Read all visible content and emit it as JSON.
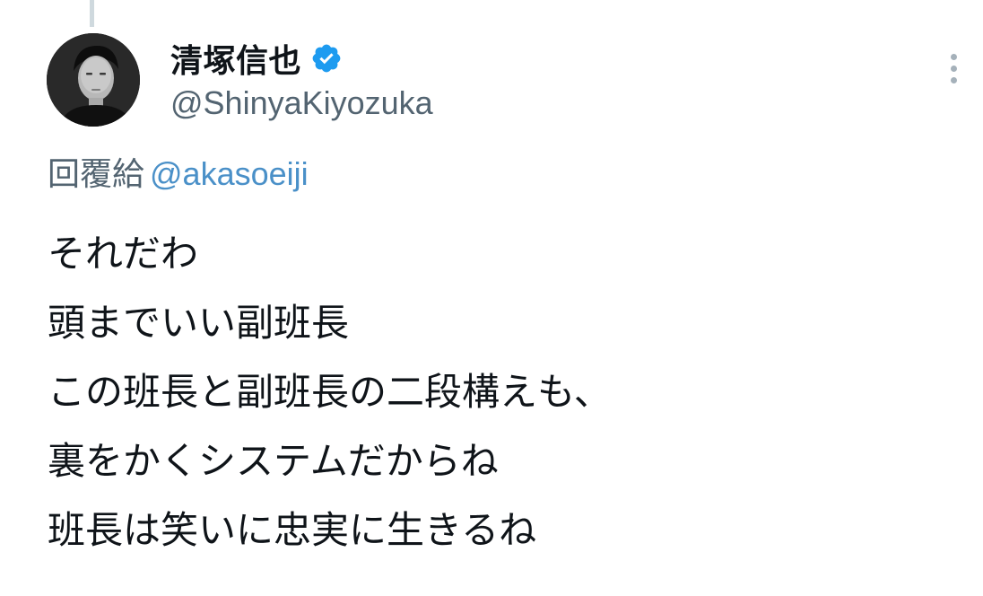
{
  "author": {
    "display_name": "清塚信也",
    "handle": "@ShinyaKiyozuka",
    "verified": true,
    "avatar_icon": "profile-photo"
  },
  "reply": {
    "label": "回覆給",
    "mention": "@akasoeiji"
  },
  "tweet": {
    "lines": [
      "それだわ",
      "頭までいい副班長",
      "この班長と副班長の二段構えも、",
      "裏をかくシステムだからね",
      "班長は笑いに忠実に生きるね"
    ]
  },
  "icons": {
    "verified": "verified-badge-icon",
    "more": "more-options-icon"
  },
  "colors": {
    "text": "#0f1419",
    "secondary": "#536471",
    "mention": "#4a90c8",
    "verified": "#1d9bf0"
  }
}
